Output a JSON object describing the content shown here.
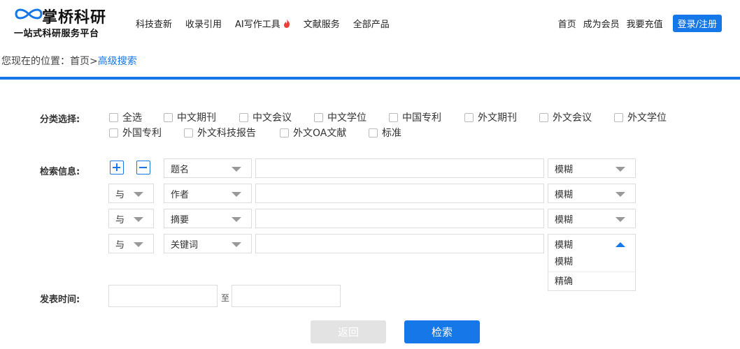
{
  "brand": {
    "name": "掌桥科研",
    "tagline": "一站式科研服务平台",
    "accent": "#1677e8"
  },
  "nav": {
    "items": [
      {
        "label": "科技查新"
      },
      {
        "label": "收录引用"
      },
      {
        "label": "AI写作工具",
        "icon": "fire-icon"
      },
      {
        "label": "文献服务"
      },
      {
        "label": "全部产品"
      }
    ]
  },
  "user_nav": {
    "home": "首页",
    "member": "成为会员",
    "recharge": "我要充值",
    "login": "登录/注册"
  },
  "breadcrumb": {
    "prefix": "您现在的位置：",
    "home": "首页",
    "separator": ">",
    "current": "高级搜索"
  },
  "form": {
    "category_label": "分类选择:",
    "categories": [
      "全选",
      "中文期刊",
      "中文会议",
      "中文学位",
      "中国专利",
      "外文期刊",
      "外文会议",
      "外文学位",
      "外国专利",
      "外文科技报告",
      "外文OA文献",
      "标准"
    ],
    "search_label": "检索信息:",
    "rows": [
      {
        "logic": "",
        "field": "题名",
        "match": "模糊",
        "value": ""
      },
      {
        "logic": "与",
        "field": "作者",
        "match": "模糊",
        "value": ""
      },
      {
        "logic": "与",
        "field": "摘要",
        "match": "模糊",
        "value": ""
      },
      {
        "logic": "与",
        "field": "关键词",
        "match": "模糊",
        "value": ""
      }
    ],
    "match_options": [
      "模糊",
      "精确"
    ],
    "date_label": "发表时间:",
    "date_separator": "至",
    "date_from": "",
    "date_to": ""
  },
  "buttons": {
    "back": "返回",
    "search": "检索"
  }
}
